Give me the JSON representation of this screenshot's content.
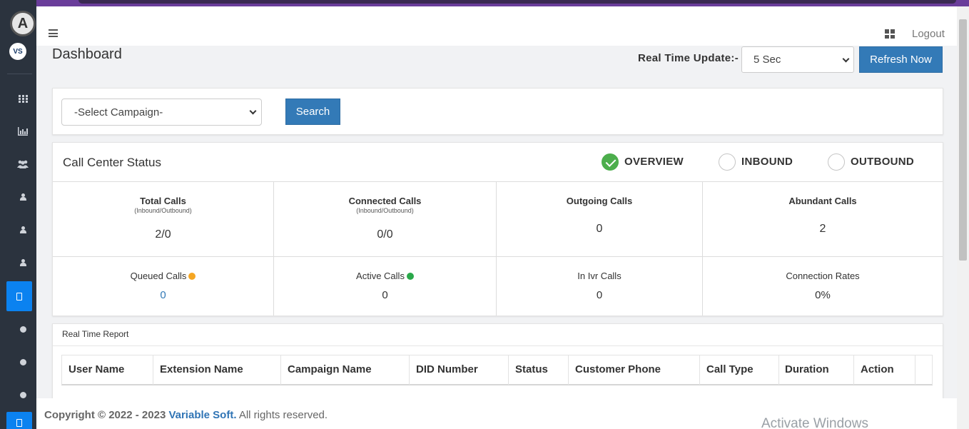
{
  "header": {
    "logout": "Logout"
  },
  "page": {
    "title": "Dashboard"
  },
  "realtime": {
    "label": "Real Time Update:-",
    "selected": "5 Sec",
    "refresh_button": "Refresh Now"
  },
  "filter": {
    "campaign_placeholder": "-Select Campaign-",
    "search_button": "Search"
  },
  "call_center": {
    "title": "Call Center Status",
    "options": [
      "OVERVIEW",
      "INBOUND",
      "OUTBOUND"
    ],
    "stats_row1": [
      {
        "title": "Total Calls",
        "sub": "(Inbound/Outbound)",
        "value": "2/0"
      },
      {
        "title": "Connected Calls",
        "sub": "(Inbound/Outbound)",
        "value": "0/0"
      },
      {
        "title": "Outgoing Calls",
        "sub": "",
        "value": "0"
      },
      {
        "title": "Abundant Calls",
        "sub": "",
        "value": "2"
      }
    ],
    "stats_row2": [
      {
        "title": "Queued Calls",
        "value": "0",
        "dot_color": "#f5a623",
        "value_color": "#337ab7"
      },
      {
        "title": "Active Calls",
        "value": "0",
        "dot_color": "#2aa84a"
      },
      {
        "title": "In Ivr Calls",
        "value": "0"
      },
      {
        "title": "Connection Rates",
        "value": "0%"
      }
    ]
  },
  "realtime_report": {
    "title": "Real Time Report",
    "columns": [
      "User Name",
      "Extension Name",
      "Campaign Name",
      "DID Number",
      "Status",
      "Customer Phone",
      "Call Type",
      "Duration",
      "Action"
    ]
  },
  "footer": {
    "copyright": "Copyright © 2022 - 2023",
    "brand": "Variable Soft.",
    "rights": "All rights reserved."
  },
  "watermark": "Activate Windows",
  "colors": {
    "sidebar": "#2b333e",
    "accent": "#337ab7",
    "active_nav": "#0b82f0",
    "top_strip": "#6a3d9a"
  }
}
